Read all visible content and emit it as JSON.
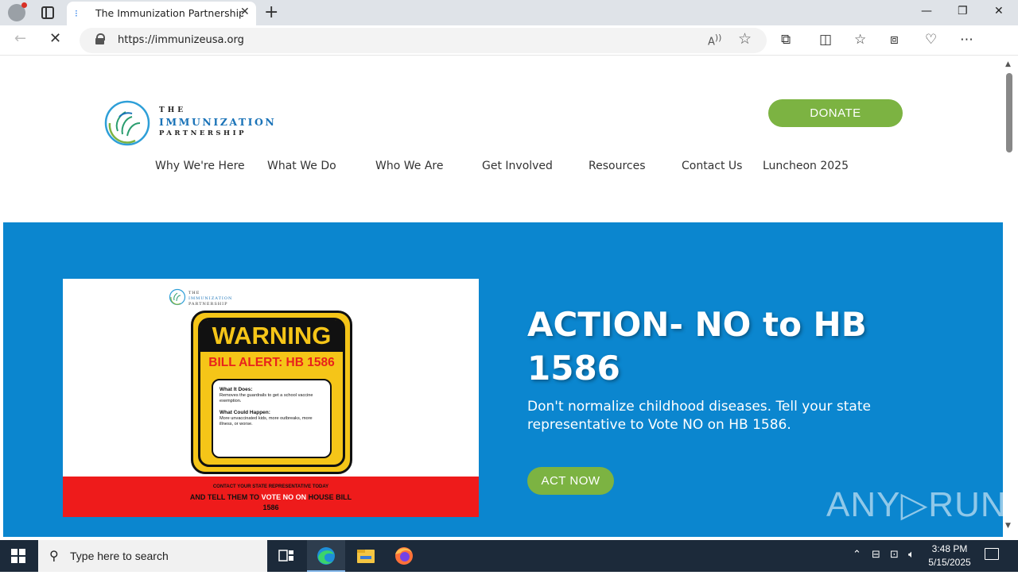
{
  "browser": {
    "tab_title": "The Immunization Partnership | Va",
    "tab_close": "✕",
    "new_tab": "+",
    "url": "https://immunizeusa.org",
    "window_controls": {
      "minimize": "—",
      "maximize": "❐",
      "close": "✕"
    },
    "icons": [
      "back-icon",
      "stop-loading-icon",
      "lock-icon",
      "read-aloud-icon",
      "favorite-star-icon",
      "extensions-icon",
      "split-screen-icon",
      "favorites-icon",
      "collections-icon",
      "browser-essentials-icon",
      "more-icon",
      "copilot-icon"
    ]
  },
  "site": {
    "logo": {
      "line1": "THE",
      "line2": "IMMUNIZATION",
      "line3": "PARTNERSHIP"
    },
    "donate_label": "DONATE",
    "nav": [
      "Why We're Here",
      "What We Do",
      "Who We Are",
      "Get Involved",
      "Resources",
      "Contact Us",
      "Luncheon 2025"
    ],
    "colors": {
      "hero_bg": "#0b86cf",
      "button_green": "#7cb342",
      "logo_blue": "#1a73b8"
    }
  },
  "hero": {
    "title": "ACTION- NO to HB 1586",
    "subtitle": "Don't normalize childhood diseases. Tell your state representative to Vote NO on HB 1586.",
    "cta_label": "ACT NOW",
    "banner": {
      "logo_line1": "THE",
      "logo_line2": "IMMUNIZATION",
      "logo_line3": "PARTNERSHIP",
      "warning": "WARNING",
      "alert": "BILL ALERT: HB 1586",
      "what_it_does_heading": "What It Does:",
      "what_it_does_text": "Removes the guardrails to get a school vaccine exemption.",
      "what_could_happen_heading": "What Could Happen:",
      "what_could_happen_text": "More unvaccinated kids, more outbreaks, more illness, or worse.",
      "footer_line1": "CONTACT YOUR STATE REPRESENTATIVE TODAY",
      "footer_line2_a": "AND TELL THEM TO",
      "footer_line2_b": "VOTE NO ON",
      "footer_line2_c": "HOUSE BILL",
      "footer_line3": "1586"
    },
    "watermark": "ANY▷RUN"
  },
  "taskbar": {
    "search_placeholder": "Type here to search",
    "time": "3:48 PM",
    "date": "5/15/2025",
    "apps": [
      "task-view-icon",
      "edge-icon",
      "file-explorer-icon",
      "firefox-icon"
    ]
  }
}
